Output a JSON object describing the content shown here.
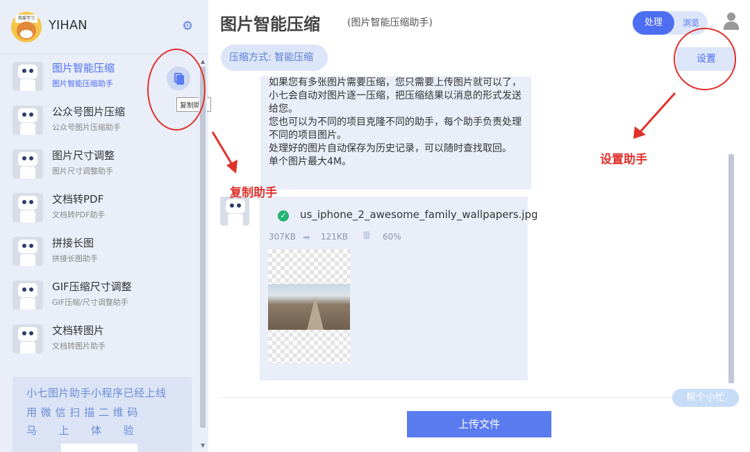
{
  "user": {
    "name": "YIHAN",
    "avatar_text": "我爱学习"
  },
  "sidebar": {
    "items": [
      {
        "title": "图片智能压缩",
        "subtitle": "图片智能压缩助手",
        "active": true
      },
      {
        "title": "公众号图片压缩",
        "subtitle": "公众号图片压缩助手"
      },
      {
        "title": "图片尺寸调整",
        "subtitle": "图片尺寸调整助手"
      },
      {
        "title": "文档转PDF",
        "subtitle": "文档转PDF助手"
      },
      {
        "title": "拼接长图",
        "subtitle": "拼接长图助手"
      },
      {
        "title": "GIF压缩尺寸调整",
        "subtitle": "GIF压缩/尺寸调整助手"
      },
      {
        "title": "文档转图片",
        "subtitle": "文档转图片助手"
      }
    ],
    "copy_tooltip": "复制助手",
    "promo": {
      "line1": "小七图片助手小程序已经上线",
      "line2": "用 微 信 扫 描 二 维 码",
      "line3": "马　　上　　体　　验"
    }
  },
  "header": {
    "title": "图片智能压缩",
    "subtitle": "(图片智能压缩助手)",
    "toggle_active": "处理",
    "toggle_inactive": "浏览",
    "mode": "压缩方式: 智能压缩",
    "settings": "设置"
  },
  "chat": {
    "intro_lines": [
      "如果您有多张图片需要压缩，您只需要上传图片就可以了，小七会自动对图片逐一压缩，把压缩结果以消息的形式发送给您。",
      "您也可以为不同的项目克隆不同的助手，每个助手负责处理不同的项目图片。",
      "处理好的图片自动保存为历史记录，可以随时查找取回。",
      "单个图片最大4M。"
    ],
    "file": {
      "name": "us_iphone_2_awesome_family_wallpapers.jpg",
      "size_before": "307KB",
      "size_after": "121KB",
      "ratio": "60%"
    }
  },
  "footer": {
    "upload": "上传文件",
    "help": "帮个小忙"
  },
  "annotations": {
    "copy_label": "复制助手",
    "settings_label": "设置助手"
  },
  "colors": {
    "accent": "#4e6ef2",
    "annotation": "#e0302b",
    "sidebar_bg": "#e9eef8"
  }
}
